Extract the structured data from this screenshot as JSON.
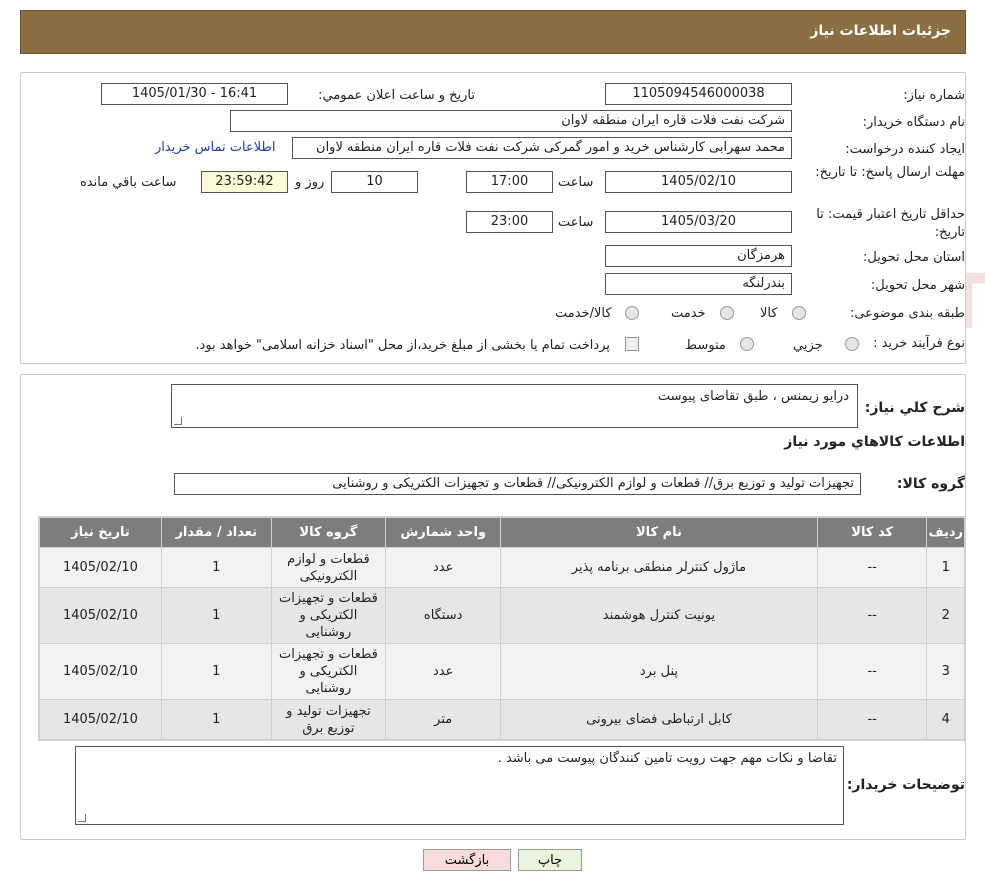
{
  "header": {
    "title": "جزئیات اطلاعات نیاز"
  },
  "watermark": {
    "text": "AriaTender.neT"
  },
  "form": {
    "need_number_label": "شماره نیاز:",
    "need_number": "1105094546000038",
    "announce_label": "تاریخ و ساعت اعلان عمومي:",
    "announce_value": "1405/01/30 - 16:41",
    "buyer_org_label": "نام دستگاه خریدار:",
    "buyer_org": "شرکت نفت فلات قاره ایران منطقه لاوان",
    "creator_label": "ایجاد کننده درخواست:",
    "creator": "محمد سهرابی کارشناس خرید و امور گمرکی شرکت نفت فلات قاره ایران منطقه لاوان",
    "contact_link": "اطلاعات تماس خریدار",
    "deadline_label": "مهلت ارسال پاسخ: تا تاریخ:",
    "deadline_date": "1405/02/10",
    "time_label": "ساعت",
    "deadline_time": "17:00",
    "days_value": "10",
    "days_label": "روز و",
    "remaining_value": "23:59:42",
    "remaining_label": "ساعت باقي مانده",
    "validity_label": "حداقل تاریخ اعتبار قیمت: تا تاریخ:",
    "validity_date": "1405/03/20",
    "validity_time": "23:00",
    "province_label": "استان محل تحویل:",
    "province": "هرمزگان",
    "city_label": "شهر محل تحویل:",
    "city": "بندرلنگه",
    "category_label": "طبقه بندی موضوعی:",
    "category_options": [
      "کالا",
      "خدمت",
      "کالا/خدمت"
    ],
    "process_label": "نوع فرآیند خرید :",
    "process_options": [
      "جزيي",
      "متوسط"
    ],
    "process_note": "پرداخت تمام یا بخشی از مبلغ خرید،از محل \"اسناد خزانه اسلامی\" خواهد بود."
  },
  "summary": {
    "label": "شرح کلي نياز:",
    "value": "درایو زیمنس ، طبق تقاضای پیوست"
  },
  "goods": {
    "section_title": "اطلاعات کالاهاي مورد نياز",
    "group_label": "گروه کالا:",
    "group_value": "تجهیزات تولید و توزیع برق// قطعات و لوازم الکترونیکی// قطعات و تجهیزات الکتریکی و روشنایی",
    "columns": [
      "ردیف",
      "کد کالا",
      "نام کالا",
      "واحد شمارش",
      "گروه کالا",
      "تعداد / مقدار",
      "تاریخ نیاز"
    ],
    "rows": [
      [
        "1",
        "--",
        "ماژول کنترلر منطقی برنامه پذیر",
        "عدد",
        "قطعات و لوازم الکترونیکی",
        "1",
        "1405/02/10"
      ],
      [
        "2",
        "--",
        "یونیت کنترل هوشمند",
        "دستگاه",
        "قطعات و تجهیزات الکتریکی و روشنایی",
        "1",
        "1405/02/10"
      ],
      [
        "3",
        "--",
        "پنل برد",
        "عدد",
        "قطعات و تجهیزات الکتریکی و روشنایی",
        "1",
        "1405/02/10"
      ],
      [
        "4",
        "--",
        "کابل ارتباطی فضای بیرونی",
        "متر",
        "تجهیزات تولید و توزیع برق",
        "1",
        "1405/02/10"
      ]
    ]
  },
  "notes": {
    "label": "توضیحات خریدار:",
    "value": "تقاضا و نکات مهم جهت رویت تامین کنندگان پیوست می باشد ."
  },
  "buttons": {
    "print": "چاپ",
    "back": "بازگشت"
  },
  "colors": {
    "header_bg": "#8b6f43",
    "table_header_bg": "#7d7d7d",
    "print_btn": "#e9f6dc",
    "back_btn": "#f8dcdc"
  }
}
